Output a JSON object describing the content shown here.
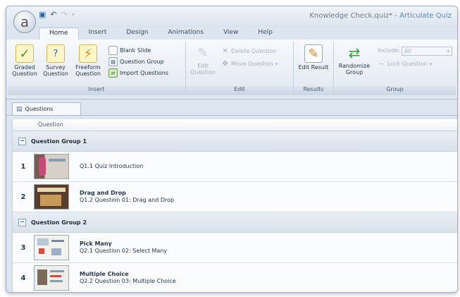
{
  "window": {
    "title_doc": "Knowledge Check.quiz* -",
    "title_app": "Articulate Quiz",
    "app_button_glyph": "a"
  },
  "quick_access": [
    {
      "icon": "save-icon",
      "glyph": "💾"
    },
    {
      "icon": "undo-icon",
      "glyph": "↶"
    },
    {
      "icon": "redo-icon",
      "glyph": "↷"
    },
    {
      "icon": "qat-dropdown-icon",
      "glyph": "▾"
    }
  ],
  "tabs": [
    "Home",
    "Insert",
    "Design",
    "Animations",
    "View",
    "Help"
  ],
  "ribbon": {
    "insert": {
      "label": "Insert",
      "graded": "Graded Question",
      "survey": "Survey Question",
      "freeform": "Freeform Question",
      "blank_slide": "Blank Slide",
      "question_group": "Question Group",
      "import_questions": "Import Questions"
    },
    "edit": {
      "label": "Edit",
      "edit_question": "Edit Question",
      "delete_question": "Delete Question",
      "move_question": "Move Question"
    },
    "results": {
      "label": "Results",
      "edit_result": "Edit Result"
    },
    "group": {
      "label": "Group",
      "randomize": "Randomize Group",
      "include_label": "Include:",
      "include_value": "All",
      "lock_question": "Lock Question"
    }
  },
  "doc_tab": "Questions",
  "list": {
    "column_header": "Question",
    "groups": [
      {
        "name": "Question Group 1",
        "questions": [
          {
            "num": "1",
            "title": "",
            "subtitle": "Q1.1 Quiz Introduction"
          },
          {
            "num": "2",
            "title": "Drag and Drop",
            "subtitle": "Q1.2 Question 01: Drag and Drop"
          }
        ]
      },
      {
        "name": "Question Group 2",
        "questions": [
          {
            "num": "3",
            "title": "Pick Many",
            "subtitle": "Q2.1 Question 02: Select Many"
          },
          {
            "num": "4",
            "title": "Multiple Choice",
            "subtitle": "Q2.2 Question 03: Multiple Choice"
          }
        ]
      }
    ]
  },
  "colors": {
    "accent": "#5a86c0",
    "ribbon_bg": "#e6edf5",
    "group_row_bg": "#dfe6ee"
  }
}
